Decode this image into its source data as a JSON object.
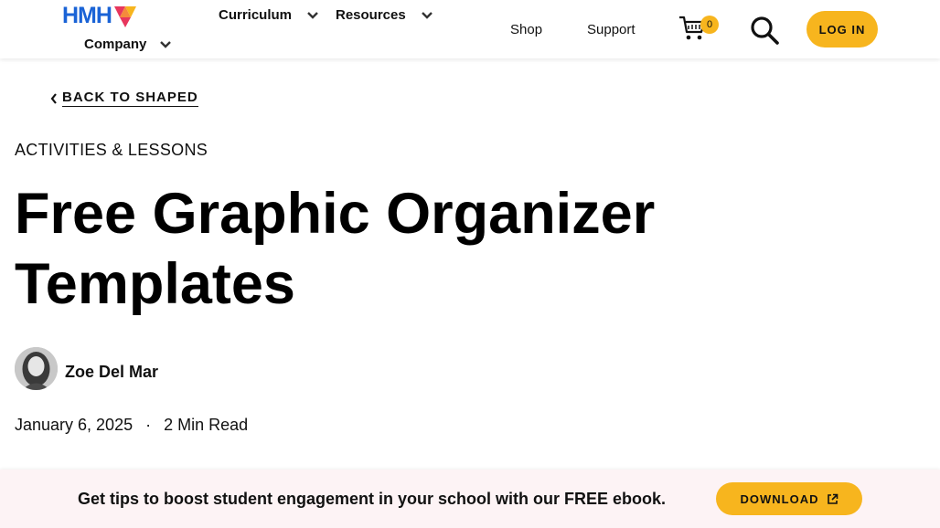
{
  "header": {
    "logo_text": "HMH",
    "nav": {
      "curriculum": "Curriculum",
      "resources": "Resources",
      "company": "Company",
      "shop": "Shop",
      "support": "Support"
    },
    "cart_count": "0",
    "login_label": "LOG IN"
  },
  "article": {
    "back_label": "BACK TO SHAPED",
    "category": "ACTIVITIES & LESSONS",
    "title": "Free Graphic Organizer Templates",
    "author": "Zoe Del Mar",
    "date": "January 6, 2025",
    "separator": "·",
    "read_time": "2 Min Read"
  },
  "banner": {
    "text": "Get tips to boost student engagement in your school with our FREE ebook.",
    "download_label": "DOWNLOAD"
  },
  "colors": {
    "accent_yellow": "#f7b51e",
    "logo_blue": "#1a63d6",
    "banner_bg": "#fdf3f5"
  }
}
